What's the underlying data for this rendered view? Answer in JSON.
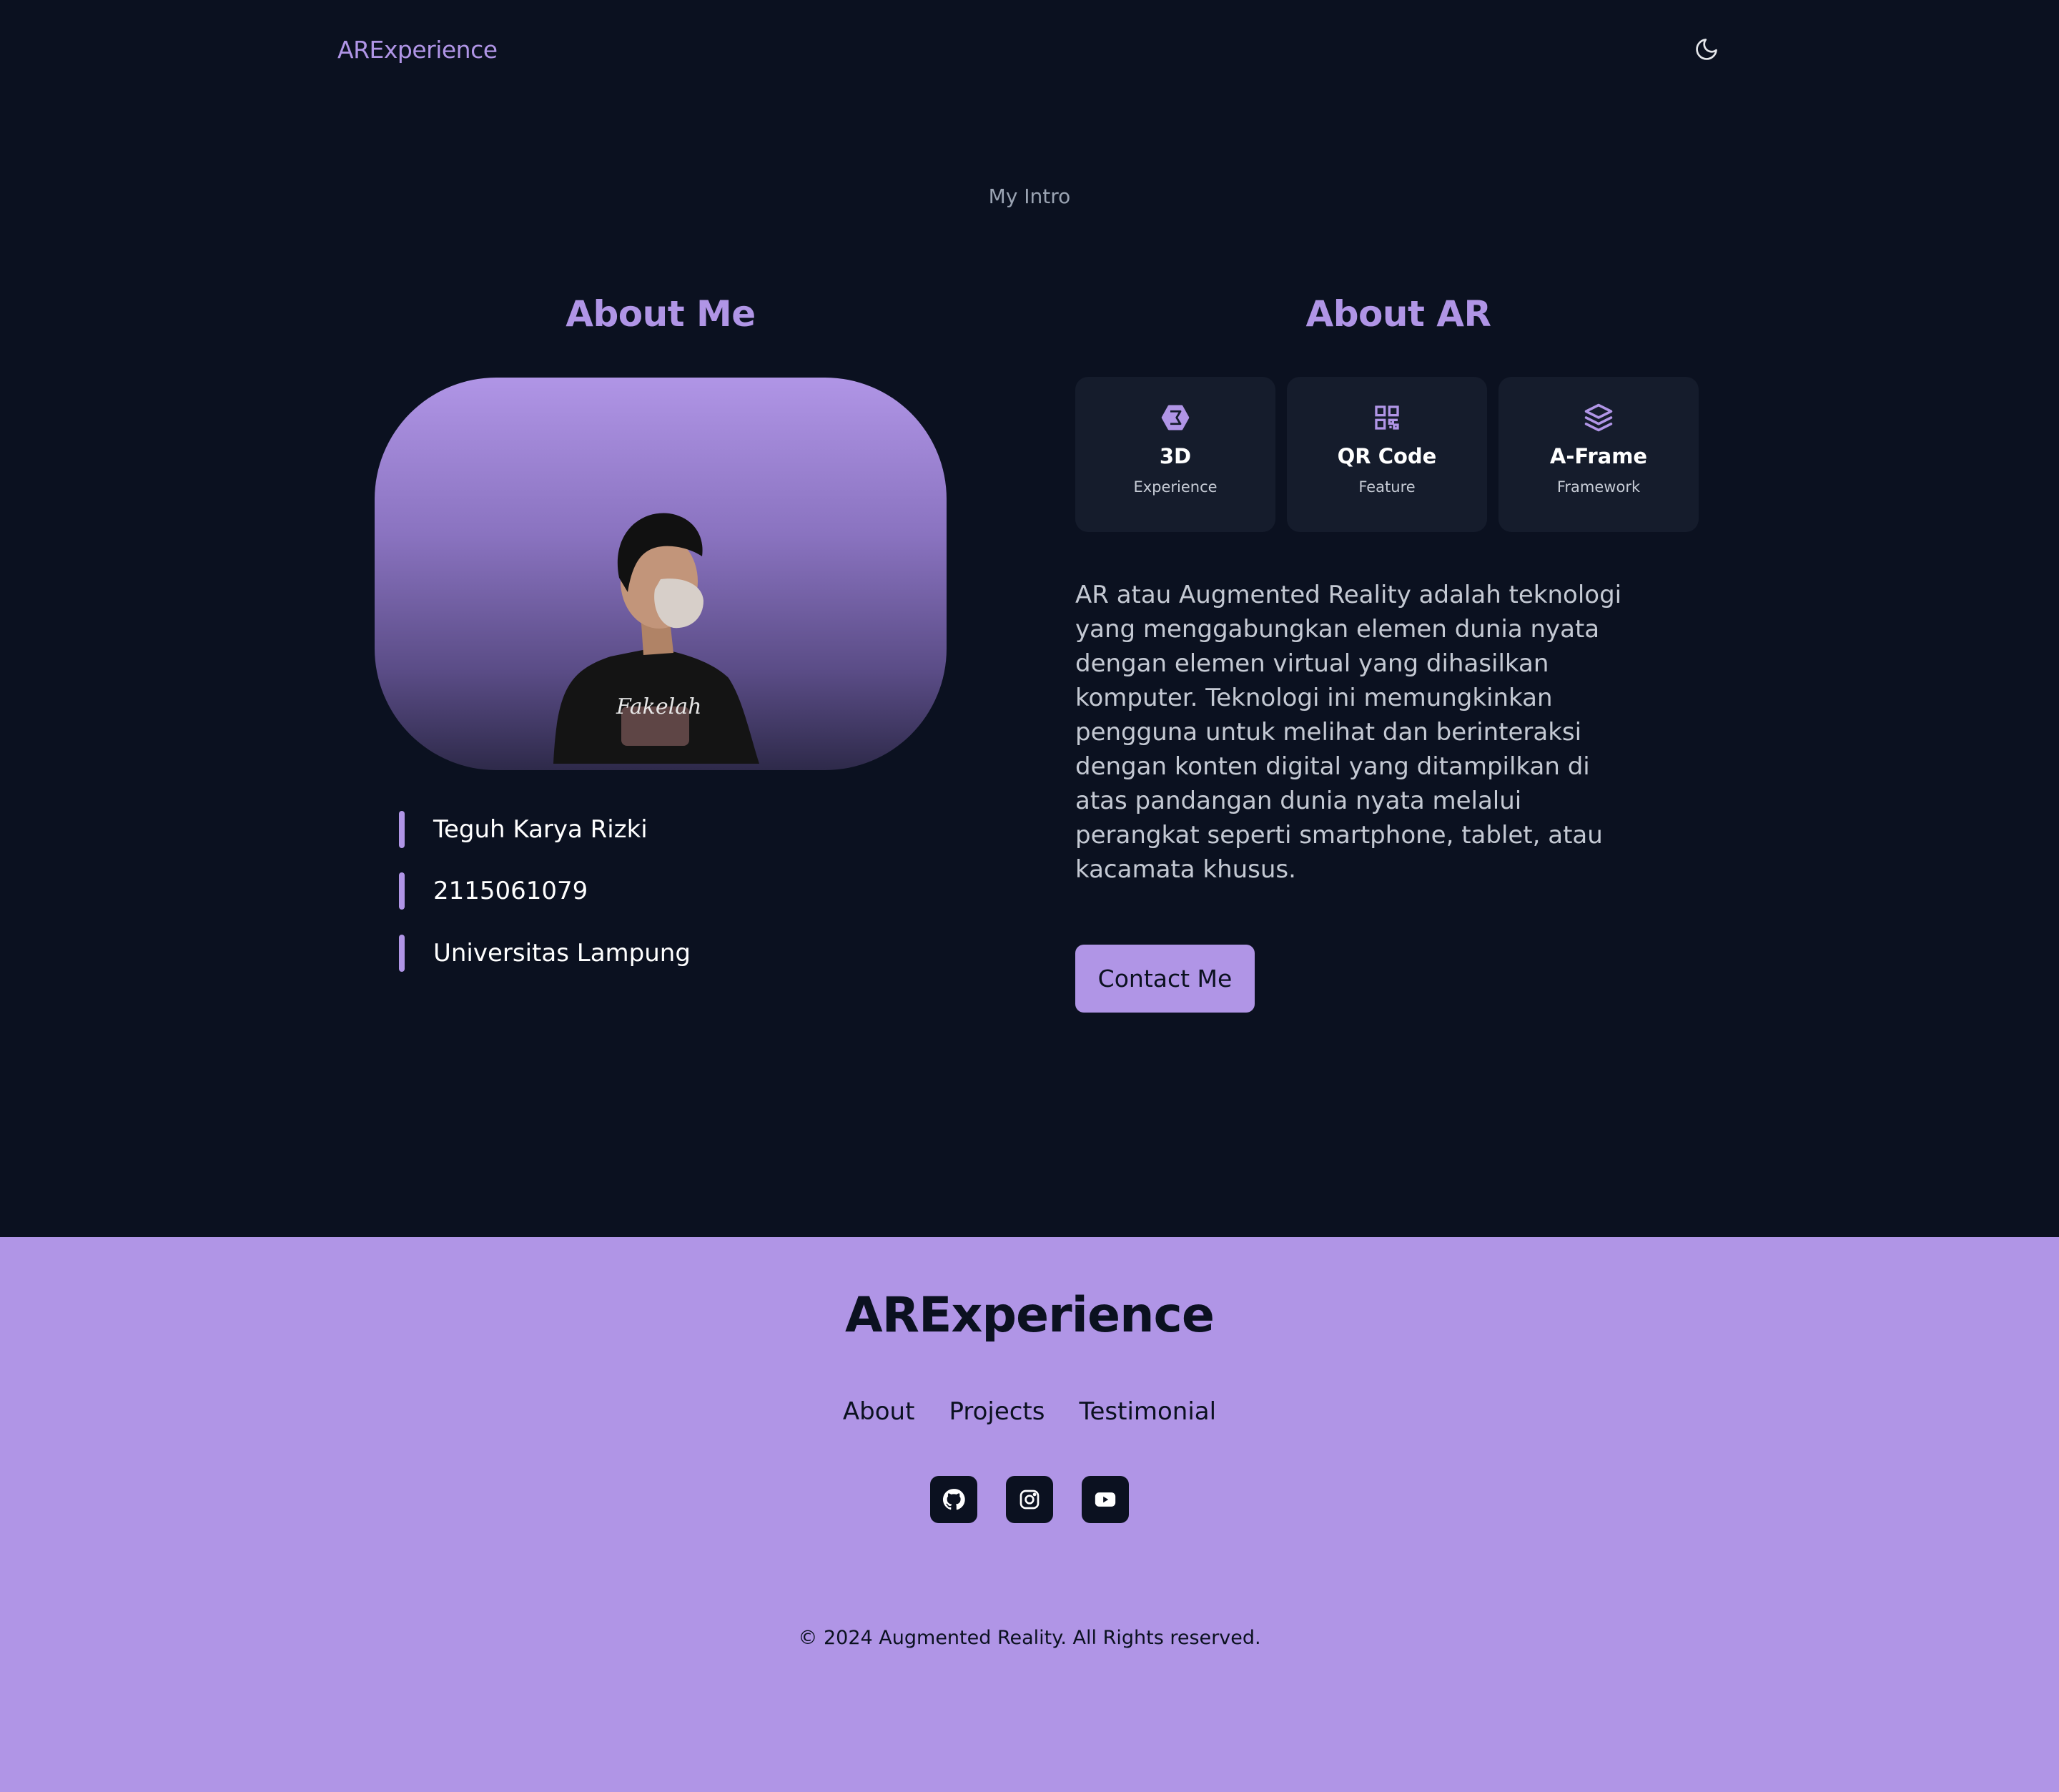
{
  "header": {
    "brand": "ARExperience",
    "theme_toggle_icon": "moon-icon"
  },
  "intro": {
    "label": "My Intro"
  },
  "about_me": {
    "heading": "About Me",
    "info": [
      {
        "text": "Teguh Karya Rizki"
      },
      {
        "text": "2115061079"
      },
      {
        "text": "Universitas Lampung"
      }
    ]
  },
  "about_ar": {
    "heading": "About AR",
    "cards": [
      {
        "title": "3D",
        "subtitle": "Experience",
        "icon": "cube-icon"
      },
      {
        "title": "QR Code",
        "subtitle": "Feature",
        "icon": "qr-code-icon"
      },
      {
        "title": "A-Frame",
        "subtitle": "Framework",
        "icon": "layers-icon"
      }
    ],
    "description": "AR atau Augmented Reality adalah teknologi yang menggabungkan elemen dunia nyata dengan elemen virtual yang dihasilkan komputer. Teknologi ini memungkinkan pengguna untuk melihat dan berinteraksi dengan konten digital yang ditampilkan di atas pandangan dunia nyata melalui perangkat seperti smartphone, tablet, atau kacamata khusus.",
    "contact_label": "Contact Me"
  },
  "footer": {
    "brand": "ARExperience",
    "links": [
      "About",
      "Projects",
      "Testimonial"
    ],
    "socials": [
      "github-icon",
      "instagram-icon",
      "youtube-icon"
    ],
    "copyright": "© 2024 Augmented Reality. All Rights reserved."
  },
  "colors": {
    "background": "#0b1120",
    "accent": "#b095e6",
    "card": "#151c2c"
  }
}
